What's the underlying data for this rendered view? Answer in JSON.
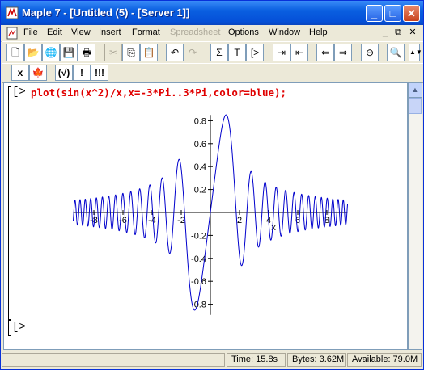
{
  "window": {
    "title": "Maple 7  - [Untitled (5) - [Server 1]]",
    "controls": {
      "minimize": "_",
      "maximize": "□",
      "close": "✕"
    }
  },
  "menubar": {
    "items": [
      "File",
      "Edit",
      "View",
      "Insert",
      "Format",
      "Spreadsheet",
      "Options",
      "Window",
      "Help"
    ],
    "disabled": [
      "Spreadsheet"
    ],
    "mdi_controls": [
      "_",
      "⧉",
      "✕"
    ]
  },
  "toolbar": {
    "buttons": [
      {
        "name": "new-icon",
        "glyph": "🗋"
      },
      {
        "name": "open-icon",
        "glyph": "📂"
      },
      {
        "name": "open-url-icon",
        "glyph": "🌐"
      },
      {
        "name": "save-icon",
        "glyph": "💾"
      },
      {
        "name": "print-icon",
        "glyph": "🖶"
      },
      {
        "name": "cut-icon",
        "glyph": "✂"
      },
      {
        "name": "copy-icon",
        "glyph": "⎘"
      },
      {
        "name": "paste-icon",
        "glyph": "📋"
      },
      {
        "name": "undo-icon",
        "glyph": "↶"
      },
      {
        "name": "redo-icon",
        "glyph": "↷"
      },
      {
        "name": "sigma-icon",
        "glyph": "Σ"
      },
      {
        "name": "text-icon",
        "glyph": "T"
      },
      {
        "name": "prompt-icon",
        "glyph": "[>"
      },
      {
        "name": "indent-icon",
        "glyph": "⇥"
      },
      {
        "name": "outdent-icon",
        "glyph": "⇤"
      },
      {
        "name": "back-icon",
        "glyph": "⇐"
      },
      {
        "name": "forward-icon",
        "glyph": "⇒"
      },
      {
        "name": "stop-icon",
        "glyph": "⊖"
      },
      {
        "name": "zoom-icon",
        "glyph": "🔍"
      }
    ]
  },
  "toolbar2": {
    "buttons": [
      {
        "name": "interrupt-icon",
        "glyph": "x"
      },
      {
        "name": "maple-leaf-icon",
        "glyph": "🍁"
      },
      {
        "name": "check-icon",
        "glyph": "(√)"
      },
      {
        "name": "execute-icon",
        "glyph": "!"
      },
      {
        "name": "execute-all-icon",
        "glyph": "!!!"
      }
    ]
  },
  "document": {
    "input_prompt": "[>",
    "command": "plot(sin(x^2)/x,x=-3*Pi..3*Pi,color=blue);",
    "empty_prompt": "[>"
  },
  "statusbar": {
    "time": "Time:  15.8s",
    "bytes": "Bytes: 3.62M",
    "available": "Available: 79.0M"
  },
  "chart_data": {
    "type": "line",
    "function": "sin(x^2)/x",
    "series": [
      {
        "color": "#0000cc"
      }
    ],
    "xlim": [
      -9.42,
      9.42
    ],
    "ylim": [
      -0.85,
      0.85
    ],
    "x_ticks": [
      "-8",
      "-6",
      "-4",
      "-2",
      "2",
      "4",
      "6",
      "8"
    ],
    "y_ticks": [
      "0.8",
      "0.6",
      "0.4",
      "0.2",
      "-0.2",
      "-0.4",
      "-0.6",
      "-0.8"
    ],
    "xlabel": "x",
    "ylabel": "",
    "title": "",
    "grid": false
  }
}
